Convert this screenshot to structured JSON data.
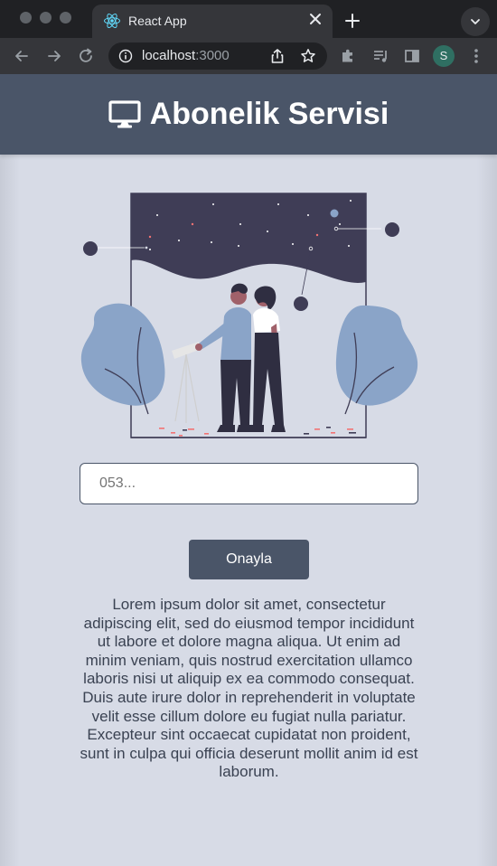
{
  "browser": {
    "tab_title": "React App",
    "url_host": "localhost",
    "url_port": ":3000",
    "profile_initial": "S"
  },
  "header": {
    "title": "Abonelik Servisi",
    "icon": "monitor-icon"
  },
  "form": {
    "phone_placeholder": "053...",
    "phone_value": "",
    "confirm_label": "Onayla"
  },
  "content": {
    "paragraph": "Lorem ipsum dolor sit amet, consectetur adipiscing elit, sed do eiusmod tempor incididunt ut labore et dolore magna aliqua. Ut enim ad minim veniam, quis nostrud exercitation ullamco laboris nisi ut aliquip ex ea commodo consequat. Duis aute irure dolor in reprehenderit in voluptate velit esse cillum dolore eu fugiat nulla pariatur. Excepteur sint occaecat cupidatat non proident, sunt in culpa qui officia deserunt mollit anim id est laborum."
  },
  "colors": {
    "header_bg": "#4a5568",
    "page_bg": "#d7dbe6",
    "accent_blue": "#8aa4c8",
    "night_sky": "#3f3d56"
  }
}
